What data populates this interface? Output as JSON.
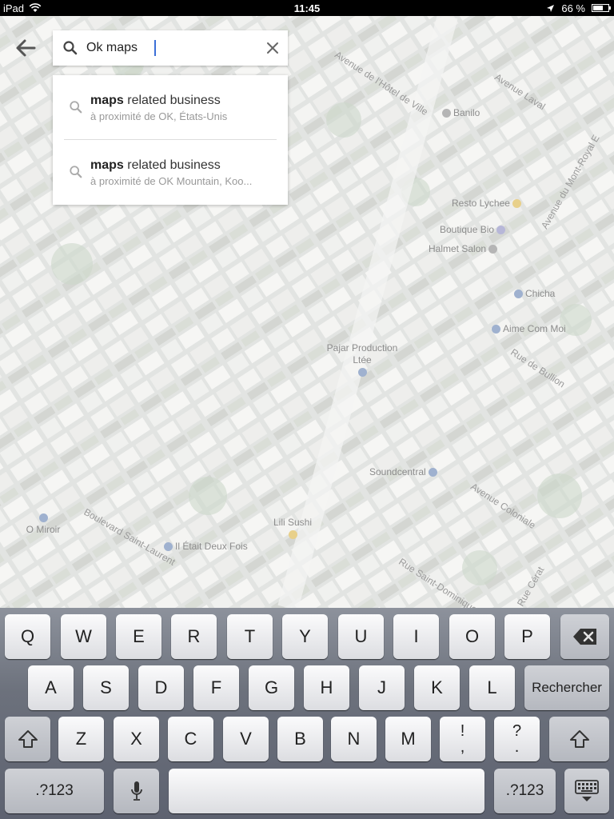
{
  "status_bar": {
    "device": "iPad",
    "time": "11:45",
    "battery": "66 %",
    "battery_level": 0.66
  },
  "search": {
    "value": "Ok maps",
    "back_icon": "back-arrow-icon",
    "search_icon": "search-icon",
    "clear_icon": "close-icon"
  },
  "suggestions": [
    {
      "bold": "maps",
      "rest": " related business",
      "sub": "à proximité de OK, États-Unis"
    },
    {
      "bold": "maps",
      "rest": " related business",
      "sub": "à proximité de OK Mountain, Koo..."
    }
  ],
  "map": {
    "places": [
      "Resto Lychee",
      "Boutique Bio",
      "Halmet Salon",
      "Chicha",
      "Aime Com Moi",
      "Pajar Production Ltée",
      "Soundcentral",
      "Lili Sushi",
      "Il Était Deux Fois",
      "O Miroir",
      "Banilo"
    ],
    "streets": [
      "Avenue de l'Hôtel de Ville",
      "Avenue Laval",
      "Avenue du Mont-Royal E",
      "Rue de Bullion",
      "Avenue Coloniale",
      "Boulevard Saint-Laurent",
      "Rue Saint-Dominique",
      "Rue Cérat"
    ]
  },
  "keyboard": {
    "row1": [
      "Q",
      "W",
      "E",
      "R",
      "T",
      "Y",
      "U",
      "I",
      "O",
      "P"
    ],
    "row2": [
      "A",
      "S",
      "D",
      "F",
      "G",
      "H",
      "J",
      "K",
      "L"
    ],
    "row3": [
      "Z",
      "X",
      "C",
      "V",
      "B",
      "N",
      "M"
    ],
    "punct1_top": "!",
    "punct1_bottom": ",",
    "punct2_top": "?",
    "punct2_bottom": ".",
    "search_key": "Rechercher",
    "numbers_key": ".?123",
    "icons": {
      "backspace": "backspace-icon",
      "shift": "shift-icon",
      "mic": "microphone-icon",
      "hide": "keyboard-hide-icon"
    }
  }
}
